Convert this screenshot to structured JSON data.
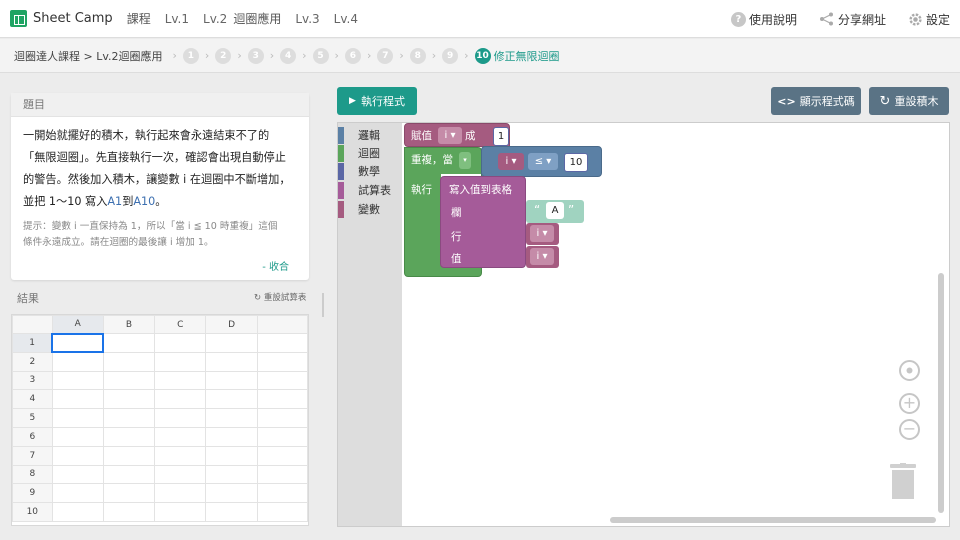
{
  "nav": {
    "brand": "Sheet Camp",
    "links": [
      "課程",
      "Lv.1",
      "Lv.2",
      "迴圈應用",
      "Lv.3",
      "Lv.4"
    ],
    "help": "使用說明",
    "share": "分享網址",
    "settings": "設定"
  },
  "breadcrumb": {
    "path": "迴圈達人課程 > Lv.2迴圈應用",
    "steps": [
      "1",
      "2",
      "3",
      "4",
      "5",
      "6",
      "7",
      "8",
      "9"
    ],
    "active_step": "10",
    "active_label": "修正無限迴圈"
  },
  "question": {
    "title": "題目",
    "line1": "一開始就擺好的積木，執行起來會永遠結束不了的",
    "line2": "「無限迴圈」。先直接執行一次，確認會出現自動停止",
    "line3": "的警告。然後加入積木，讓變數 i 在迴圈中不斷增加，",
    "line4_pre": "並把 1～10 寫入",
    "line4_a1": "A1",
    "line4_mid": "到",
    "line4_a10": "A10",
    "line4_post": "。",
    "hint1": "提示：變數 i 一直保持為 1，所以「當 i ≦ 10 時重複」這個",
    "hint2": "條件永遠成立。請在迴圈的最後讓 i 增加 1。",
    "collapse": "- 收合"
  },
  "result": {
    "title": "結果",
    "reset": "重設試算表",
    "columns": [
      "A",
      "B",
      "C",
      "D"
    ],
    "rows": [
      "1",
      "2",
      "3",
      "4",
      "5",
      "6",
      "7",
      "8",
      "9",
      "10"
    ]
  },
  "toolbar": {
    "run": "執行程式",
    "show_code": "顯示程式碼",
    "reset_blocks": "重設積木"
  },
  "toolbox": {
    "categories": [
      {
        "label": "邏輯",
        "color": "#5b80a5"
      },
      {
        "label": "迴圈",
        "color": "#5ba55b"
      },
      {
        "label": "數學",
        "color": "#5b67a5"
      },
      {
        "label": "試算表",
        "color": "#a55b99"
      },
      {
        "label": "變數",
        "color": "#a55b80"
      }
    ]
  },
  "blocks": {
    "assign": "賦值",
    "assign_to": "成",
    "var": "i",
    "one": "1",
    "repeat": "重複，當",
    "lte": "≤",
    "ten": "10",
    "do": "執行",
    "write": "寫入值到表格",
    "col": "欄",
    "row": "行",
    "val": "值",
    "str_open": "“",
    "str_val": "A",
    "str_close": "”"
  },
  "colors": {
    "accent": "#1d9a8a",
    "secondary_button": "#5a7385",
    "loop_block": "#5ba55b",
    "variable_block": "#a55b80",
    "sheet_block": "#a55b99",
    "math_block": "#5b67a5",
    "logic_block": "#5b80a5"
  }
}
